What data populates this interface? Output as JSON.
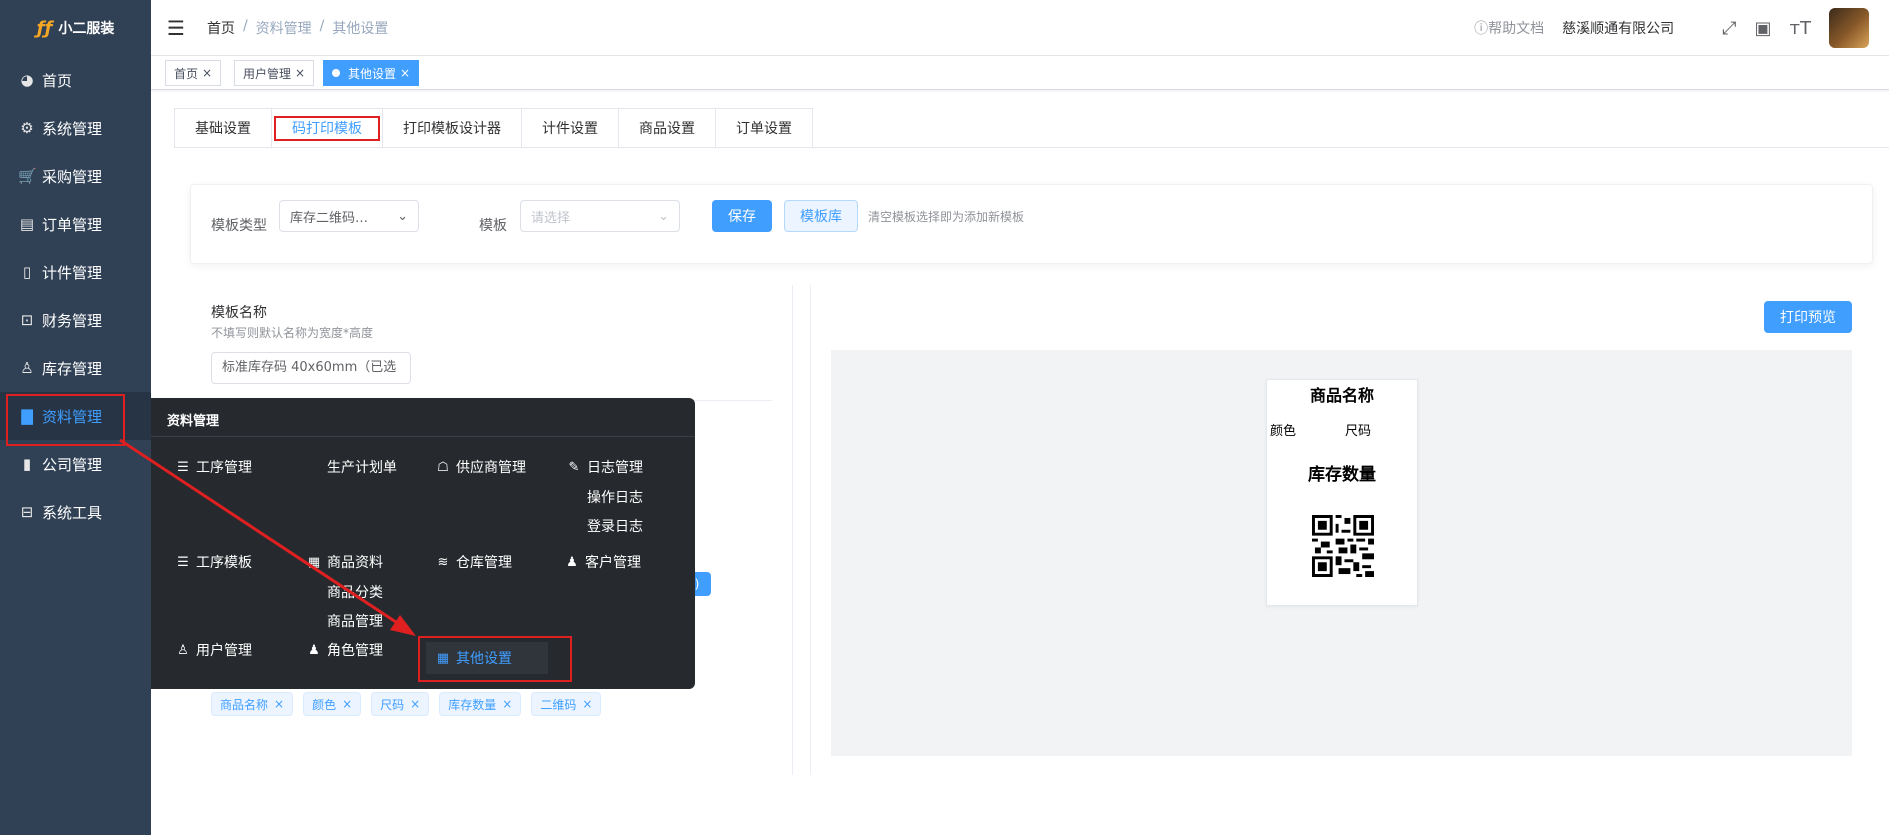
{
  "app": {
    "logo_mark": "ƒƒ",
    "name": "小二服装"
  },
  "sidebar": {
    "items": [
      {
        "label": "首页",
        "icon": "dashboard-icon",
        "glyph": "◕"
      },
      {
        "label": "系统管理",
        "icon": "gear-icon",
        "glyph": "⚙"
      },
      {
        "label": "采购管理",
        "icon": "cart-icon",
        "glyph": "🛒"
      },
      {
        "label": "订单管理",
        "icon": "order-icon",
        "glyph": "▤"
      },
      {
        "label": "计件管理",
        "icon": "book-icon",
        "glyph": "▯"
      },
      {
        "label": "财务管理",
        "icon": "chart-icon",
        "glyph": "⊡"
      },
      {
        "label": "库存管理",
        "icon": "user-icon",
        "glyph": "♙"
      },
      {
        "label": "资料管理",
        "icon": "document-icon",
        "glyph": "▇"
      },
      {
        "label": "公司管理",
        "icon": "bar-chart-icon",
        "glyph": "▮"
      },
      {
        "label": "系统工具",
        "icon": "toolbox-icon",
        "glyph": "⊟"
      }
    ]
  },
  "header": {
    "breadcrumb": [
      "首页",
      "/",
      "资料管理",
      "/",
      "其他设置"
    ],
    "help": "帮助文档",
    "company": "慈溪顺通有限公司"
  },
  "tags": [
    {
      "label": "首页"
    },
    {
      "label": "用户管理"
    },
    {
      "label": "其他设置"
    }
  ],
  "tabs": [
    "基础设置",
    "码打印模板",
    "打印模板设计器",
    "计件设置",
    "商品设置",
    "订单设置"
  ],
  "filter": {
    "type_label": "模板类型",
    "type_value": "库存二维码…",
    "template_label": "模板",
    "template_placeholder": "请选择",
    "save": "保存",
    "library": "模板库",
    "hint": "清空模板选择即为添加新模板"
  },
  "form": {
    "name_label": "模板名称",
    "name_sub": "不填写则默认名称为宽度*高度",
    "name_value": "标准库存码 40x60mm（已选",
    "field_tags": [
      "商品名称",
      "颜色",
      "尺码",
      "库存数量",
      "二维码"
    ]
  },
  "preview": {
    "print_button": "打印预览",
    "label": {
      "name": "商品名称",
      "color": "颜色",
      "size": "尺码",
      "stock": "库存数量"
    }
  },
  "flyout": {
    "title": "资料管理",
    "items": [
      {
        "label": "工序管理",
        "icon": "list-icon"
      },
      {
        "label": "生产计划单",
        "icon": ""
      },
      {
        "label": "供应商管理",
        "icon": "supplier-icon"
      },
      {
        "label": "日志管理",
        "icon": "edit-icon"
      },
      {
        "label": "操作日志",
        "icon": ""
      },
      {
        "label": "登录日志",
        "icon": ""
      },
      {
        "label": "工序模板",
        "icon": "list-icon"
      },
      {
        "label": "商品资料",
        "icon": "grid-icon"
      },
      {
        "label": "仓库管理",
        "icon": "stack-icon"
      },
      {
        "label": "客户管理",
        "icon": "users-icon"
      },
      {
        "label": "商品分类",
        "icon": ""
      },
      {
        "label": "商品管理",
        "icon": ""
      },
      {
        "label": "用户管理",
        "icon": "person-icon"
      },
      {
        "label": "角色管理",
        "icon": "users-icon"
      },
      {
        "label": "其他设置",
        "icon": "grid-icon"
      }
    ]
  },
  "colors": {
    "primary": "#409eff",
    "sidebar": "#304156",
    "flyout": "#262a2e",
    "annotation": "#e02020"
  }
}
